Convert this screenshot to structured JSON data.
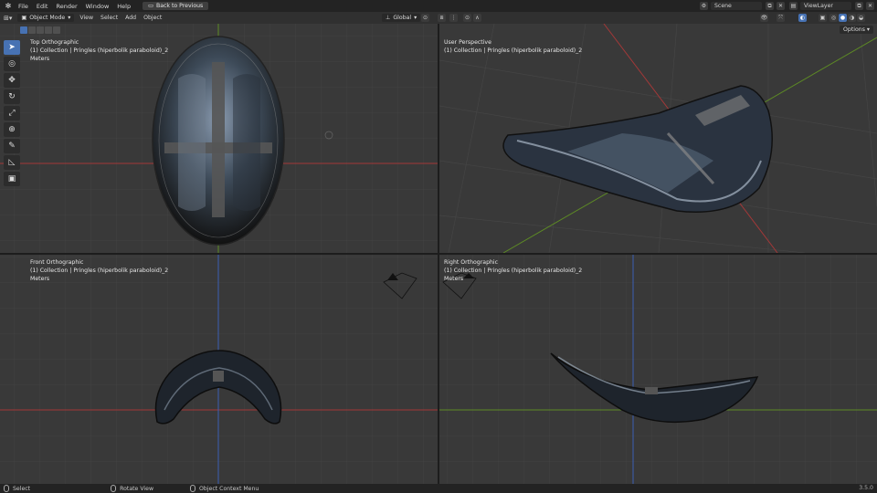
{
  "topbar": {
    "menu": [
      "File",
      "Edit",
      "Render",
      "Window",
      "Help"
    ],
    "back_button": "Back to Previous",
    "scene": "Scene",
    "view_layer": "ViewLayer"
  },
  "header": {
    "mode": "Object Mode",
    "items": [
      "View",
      "Select",
      "Add",
      "Object"
    ],
    "transform_orientation": "Global",
    "options": "Options"
  },
  "viewports": {
    "top": {
      "title": "Top Orthographic",
      "collection": "(1) Collection | Pringles (hiperbolik paraboloid)_2",
      "units": "Meters"
    },
    "perspective": {
      "title": "User Perspective",
      "collection": "(1) Collection | Pringles (hiperbolik paraboloid)_2"
    },
    "front": {
      "title": "Front Orthographic",
      "collection": "(1) Collection | Pringles (hiperbolik paraboloid)_2",
      "units": "Meters"
    },
    "right": {
      "title": "Right Orthographic",
      "collection": "(1) Collection | Pringles (hiperbolik paraboloid)_2",
      "units": "Meters"
    }
  },
  "toolbar": {
    "tools": [
      "select-box-icon",
      "cursor-icon",
      "move-icon",
      "rotate-icon",
      "scale-icon",
      "transform-icon",
      "annotate-icon",
      "measure-icon",
      "add-cube-icon"
    ]
  },
  "statusbar": {
    "select": "Select",
    "rotate": "Rotate View",
    "context": "Object Context Menu",
    "version": "3.5.0"
  },
  "colors": {
    "accent": "#4772b3",
    "x_axis": "#b33a3a",
    "y_axis": "#6a9a2a",
    "z_axis": "#3a5fb3",
    "viewport_bg": "#393939"
  }
}
